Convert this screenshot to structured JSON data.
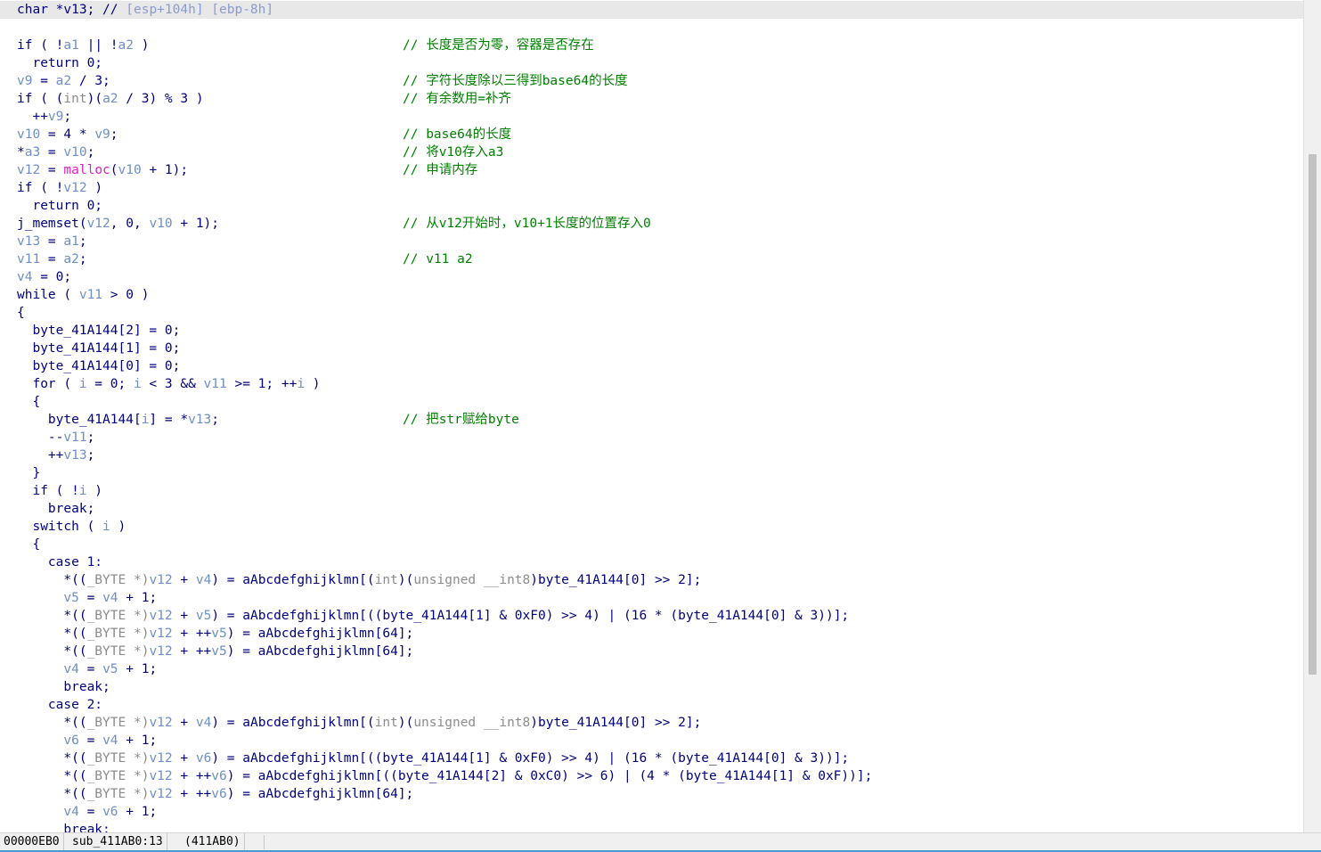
{
  "code": [
    [
      {
        "t": "char *",
        "c": "k"
      },
      {
        "t": "v13",
        "c": "k"
      },
      {
        "t": "; // ",
        "c": "k"
      },
      {
        "t": "[esp+104h] [ebp-8h]",
        "c": "cm"
      }
    ],
    [],
    [
      {
        "t": "if ( !",
        "c": "k"
      },
      {
        "t": "a1",
        "c": "v"
      },
      {
        "t": " || !",
        "c": "k"
      },
      {
        "t": "a2",
        "c": "v"
      },
      {
        "t": " )",
        "c": "k"
      }
    ],
    [
      {
        "t": "  return 0;",
        "c": "k"
      }
    ],
    [
      {
        "t": "v9",
        "c": "v"
      },
      {
        "t": " = ",
        "c": "k"
      },
      {
        "t": "a2",
        "c": "v"
      },
      {
        "t": " / 3;",
        "c": "k"
      }
    ],
    [
      {
        "t": "if ( (",
        "c": "k"
      },
      {
        "t": "int",
        "c": "ty"
      },
      {
        "t": ")(",
        "c": "k"
      },
      {
        "t": "a2",
        "c": "v"
      },
      {
        "t": " / 3) % 3 )",
        "c": "k"
      }
    ],
    [
      {
        "t": "  ++",
        "c": "k"
      },
      {
        "t": "v9",
        "c": "v"
      },
      {
        "t": ";",
        "c": "k"
      }
    ],
    [
      {
        "t": "v10",
        "c": "v"
      },
      {
        "t": " = 4 * ",
        "c": "k"
      },
      {
        "t": "v9",
        "c": "v"
      },
      {
        "t": ";",
        "c": "k"
      }
    ],
    [
      {
        "t": "*",
        "c": "k"
      },
      {
        "t": "a3",
        "c": "v"
      },
      {
        "t": " = ",
        "c": "k"
      },
      {
        "t": "v10",
        "c": "v"
      },
      {
        "t": ";",
        "c": "k"
      }
    ],
    [
      {
        "t": "v12",
        "c": "v"
      },
      {
        "t": " = ",
        "c": "k"
      },
      {
        "t": "malloc",
        "c": "f"
      },
      {
        "t": "(",
        "c": "k"
      },
      {
        "t": "v10",
        "c": "v"
      },
      {
        "t": " + 1);",
        "c": "k"
      }
    ],
    [
      {
        "t": "if ( !",
        "c": "k"
      },
      {
        "t": "v12",
        "c": "v"
      },
      {
        "t": " )",
        "c": "k"
      }
    ],
    [
      {
        "t": "  return 0;",
        "c": "k"
      }
    ],
    [
      {
        "t": "j_memset",
        "c": "k"
      },
      {
        "t": "(",
        "c": "k"
      },
      {
        "t": "v12",
        "c": "v"
      },
      {
        "t": ", 0, ",
        "c": "k"
      },
      {
        "t": "v10",
        "c": "v"
      },
      {
        "t": " + 1);",
        "c": "k"
      }
    ],
    [
      {
        "t": "v13",
        "c": "v"
      },
      {
        "t": " = ",
        "c": "k"
      },
      {
        "t": "a1",
        "c": "v"
      },
      {
        "t": ";",
        "c": "k"
      }
    ],
    [
      {
        "t": "v11",
        "c": "v"
      },
      {
        "t": " = ",
        "c": "k"
      },
      {
        "t": "a2",
        "c": "v"
      },
      {
        "t": ";",
        "c": "k"
      }
    ],
    [
      {
        "t": "v4",
        "c": "v"
      },
      {
        "t": " = 0;",
        "c": "k"
      }
    ],
    [
      {
        "t": "while ( ",
        "c": "k"
      },
      {
        "t": "v11",
        "c": "v"
      },
      {
        "t": " > 0 )",
        "c": "k"
      }
    ],
    [
      {
        "t": "{",
        "c": "k"
      }
    ],
    [
      {
        "t": "  byte_41A144[2] = 0;",
        "c": "k"
      }
    ],
    [
      {
        "t": "  byte_41A144[1] = 0;",
        "c": "k"
      }
    ],
    [
      {
        "t": "  byte_41A144[0] = 0;",
        "c": "k"
      }
    ],
    [
      {
        "t": "  for ( ",
        "c": "k"
      },
      {
        "t": "i",
        "c": "v"
      },
      {
        "t": " = 0; ",
        "c": "k"
      },
      {
        "t": "i",
        "c": "v"
      },
      {
        "t": " < 3 && ",
        "c": "k"
      },
      {
        "t": "v11",
        "c": "v"
      },
      {
        "t": " >= 1; ++",
        "c": "k"
      },
      {
        "t": "i",
        "c": "v"
      },
      {
        "t": " )",
        "c": "k"
      }
    ],
    [
      {
        "t": "  {",
        "c": "k"
      }
    ],
    [
      {
        "t": "    byte_41A144[",
        "c": "k"
      },
      {
        "t": "i",
        "c": "v"
      },
      {
        "t": "] = *",
        "c": "k"
      },
      {
        "t": "v13",
        "c": "v"
      },
      {
        "t": ";",
        "c": "k"
      }
    ],
    [
      {
        "t": "    --",
        "c": "k"
      },
      {
        "t": "v11",
        "c": "v"
      },
      {
        "t": ";",
        "c": "k"
      }
    ],
    [
      {
        "t": "    ++",
        "c": "k"
      },
      {
        "t": "v13",
        "c": "v"
      },
      {
        "t": ";",
        "c": "k"
      }
    ],
    [
      {
        "t": "  }",
        "c": "k"
      }
    ],
    [
      {
        "t": "  if ( !",
        "c": "k"
      },
      {
        "t": "i",
        "c": "v"
      },
      {
        "t": " )",
        "c": "k"
      }
    ],
    [
      {
        "t": "    break;",
        "c": "k"
      }
    ],
    [
      {
        "t": "  switch ( ",
        "c": "k"
      },
      {
        "t": "i",
        "c": "v"
      },
      {
        "t": " )",
        "c": "k"
      }
    ],
    [
      {
        "t": "  {",
        "c": "k"
      }
    ],
    [
      {
        "t": "    case 1:",
        "c": "k"
      }
    ],
    [
      {
        "t": "      *((",
        "c": "k"
      },
      {
        "t": "_BYTE",
        "c": "ty"
      },
      {
        "t": " *)",
        "c": "ty"
      },
      {
        "t": "v12",
        "c": "v"
      },
      {
        "t": " + ",
        "c": "k"
      },
      {
        "t": "v4",
        "c": "v"
      },
      {
        "t": ") = aAbcdefghijklmn[(",
        "c": "k"
      },
      {
        "t": "int",
        "c": "ty"
      },
      {
        "t": ")(",
        "c": "k"
      },
      {
        "t": "unsigned __int8",
        "c": "ty"
      },
      {
        "t": ")byte_41A144[0] >> 2];",
        "c": "k"
      }
    ],
    [
      {
        "t": "      ",
        "c": "k"
      },
      {
        "t": "v5",
        "c": "v"
      },
      {
        "t": " = ",
        "c": "k"
      },
      {
        "t": "v4",
        "c": "v"
      },
      {
        "t": " + 1;",
        "c": "k"
      }
    ],
    [
      {
        "t": "      *((",
        "c": "k"
      },
      {
        "t": "_BYTE",
        "c": "ty"
      },
      {
        "t": " *)",
        "c": "ty"
      },
      {
        "t": "v12",
        "c": "v"
      },
      {
        "t": " + ",
        "c": "k"
      },
      {
        "t": "v5",
        "c": "v"
      },
      {
        "t": ") = aAbcdefghijklmn[((byte_41A144[1] & 0xF0) >> 4) | (16 * (byte_41A144[0] & 3))];",
        "c": "k"
      }
    ],
    [
      {
        "t": "      *((",
        "c": "k"
      },
      {
        "t": "_BYTE",
        "c": "ty"
      },
      {
        "t": " *)",
        "c": "ty"
      },
      {
        "t": "v12",
        "c": "v"
      },
      {
        "t": " + ++",
        "c": "k"
      },
      {
        "t": "v5",
        "c": "v"
      },
      {
        "t": ") = aAbcdefghijklmn[64];",
        "c": "k"
      }
    ],
    [
      {
        "t": "      *((",
        "c": "k"
      },
      {
        "t": "_BYTE",
        "c": "ty"
      },
      {
        "t": " *)",
        "c": "ty"
      },
      {
        "t": "v12",
        "c": "v"
      },
      {
        "t": " + ++",
        "c": "k"
      },
      {
        "t": "v5",
        "c": "v"
      },
      {
        "t": ") = aAbcdefghijklmn[64];",
        "c": "k"
      }
    ],
    [
      {
        "t": "      ",
        "c": "k"
      },
      {
        "t": "v4",
        "c": "v"
      },
      {
        "t": " = ",
        "c": "k"
      },
      {
        "t": "v5",
        "c": "v"
      },
      {
        "t": " + 1;",
        "c": "k"
      }
    ],
    [
      {
        "t": "      break;",
        "c": "k"
      }
    ],
    [
      {
        "t": "    case 2:",
        "c": "k"
      }
    ],
    [
      {
        "t": "      *((",
        "c": "k"
      },
      {
        "t": "_BYTE",
        "c": "ty"
      },
      {
        "t": " *)",
        "c": "ty"
      },
      {
        "t": "v12",
        "c": "v"
      },
      {
        "t": " + ",
        "c": "k"
      },
      {
        "t": "v4",
        "c": "v"
      },
      {
        "t": ") = aAbcdefghijklmn[(",
        "c": "k"
      },
      {
        "t": "int",
        "c": "ty"
      },
      {
        "t": ")(",
        "c": "k"
      },
      {
        "t": "unsigned __int8",
        "c": "ty"
      },
      {
        "t": ")byte_41A144[0] >> 2];",
        "c": "k"
      }
    ],
    [
      {
        "t": "      ",
        "c": "k"
      },
      {
        "t": "v6",
        "c": "v"
      },
      {
        "t": " = ",
        "c": "k"
      },
      {
        "t": "v4",
        "c": "v"
      },
      {
        "t": " + 1;",
        "c": "k"
      }
    ],
    [
      {
        "t": "      *((",
        "c": "k"
      },
      {
        "t": "_BYTE",
        "c": "ty"
      },
      {
        "t": " *)",
        "c": "ty"
      },
      {
        "t": "v12",
        "c": "v"
      },
      {
        "t": " + ",
        "c": "k"
      },
      {
        "t": "v6",
        "c": "v"
      },
      {
        "t": ") = aAbcdefghijklmn[((byte_41A144[1] & 0xF0) >> 4) | (16 * (byte_41A144[0] & 3))];",
        "c": "k"
      }
    ],
    [
      {
        "t": "      *((",
        "c": "k"
      },
      {
        "t": "_BYTE",
        "c": "ty"
      },
      {
        "t": " *)",
        "c": "ty"
      },
      {
        "t": "v12",
        "c": "v"
      },
      {
        "t": " + ++",
        "c": "k"
      },
      {
        "t": "v6",
        "c": "v"
      },
      {
        "t": ") = aAbcdefghijklmn[((byte_41A144[2] & 0xC0) >> 6) | (4 * (byte_41A144[1] & 0xF))];",
        "c": "k"
      }
    ],
    [
      {
        "t": "      *((",
        "c": "k"
      },
      {
        "t": "_BYTE",
        "c": "ty"
      },
      {
        "t": " *)",
        "c": "ty"
      },
      {
        "t": "v12",
        "c": "v"
      },
      {
        "t": " + ++",
        "c": "k"
      },
      {
        "t": "v6",
        "c": "v"
      },
      {
        "t": ") = aAbcdefghijklmn[64];",
        "c": "k"
      }
    ],
    [
      {
        "t": "      ",
        "c": "k"
      },
      {
        "t": "v4",
        "c": "v"
      },
      {
        "t": " = ",
        "c": "k"
      },
      {
        "t": "v6",
        "c": "v"
      },
      {
        "t": " + 1;",
        "c": "k"
      }
    ],
    [
      {
        "t": "      break;",
        "c": "k"
      }
    ]
  ],
  "comments": {
    "2": "// 长度是否为零，容器是否存在",
    "4": "// 字符长度除以三得到base64的长度",
    "5": "// 有余数用=补齐",
    "7": "// base64的长度",
    "8": "// 将v10存入a3",
    "9": "// 申请内存",
    "12": "// 从v12开始时，v10+1长度的位置存入0",
    "14": "// v11 a2",
    "23": "// 把str赋给byte"
  },
  "statusbar": {
    "address": "00000EB0",
    "location": "sub_411AB0:13",
    "ea": "(411AB0)"
  },
  "scrollbar": {
    "thumb_start": 0.185,
    "thumb_end": 0.81
  },
  "colors": {
    "keyword": "#000080",
    "variable": "#6e8fc7",
    "function": "#e020c0",
    "type": "#8c8c8c",
    "comment": "#008000",
    "highlight": "#e8e8e8"
  }
}
